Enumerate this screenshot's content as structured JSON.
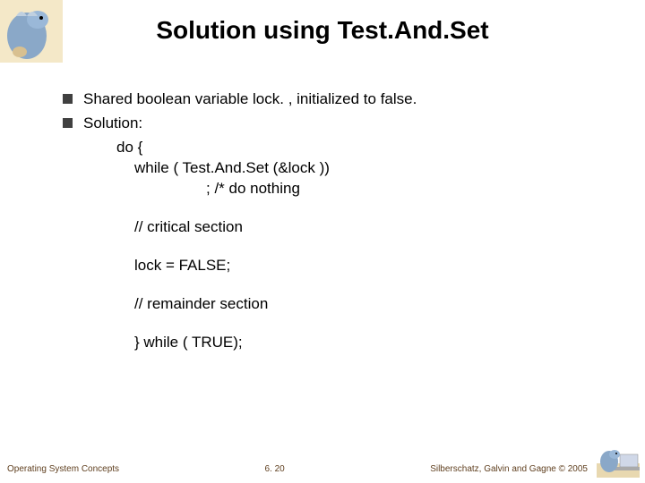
{
  "title": "Solution using Test.And.Set",
  "bullets": {
    "b1": "Shared boolean variable lock. , initialized to false.",
    "b2": "Solution:"
  },
  "code": {
    "l1": "do {",
    "l2": "while ( Test.And.Set (&lock ))",
    "l3": ";   /* do nothing",
    "l4": "//    critical section",
    "l5": "lock = FALSE;",
    "l6": "//      remainder section",
    "l7": "} while ( TRUE);"
  },
  "footer": {
    "left": "Operating System Concepts",
    "center": "6. 20",
    "right": "Silberschatz, Galvin and Gagne © 2005"
  }
}
